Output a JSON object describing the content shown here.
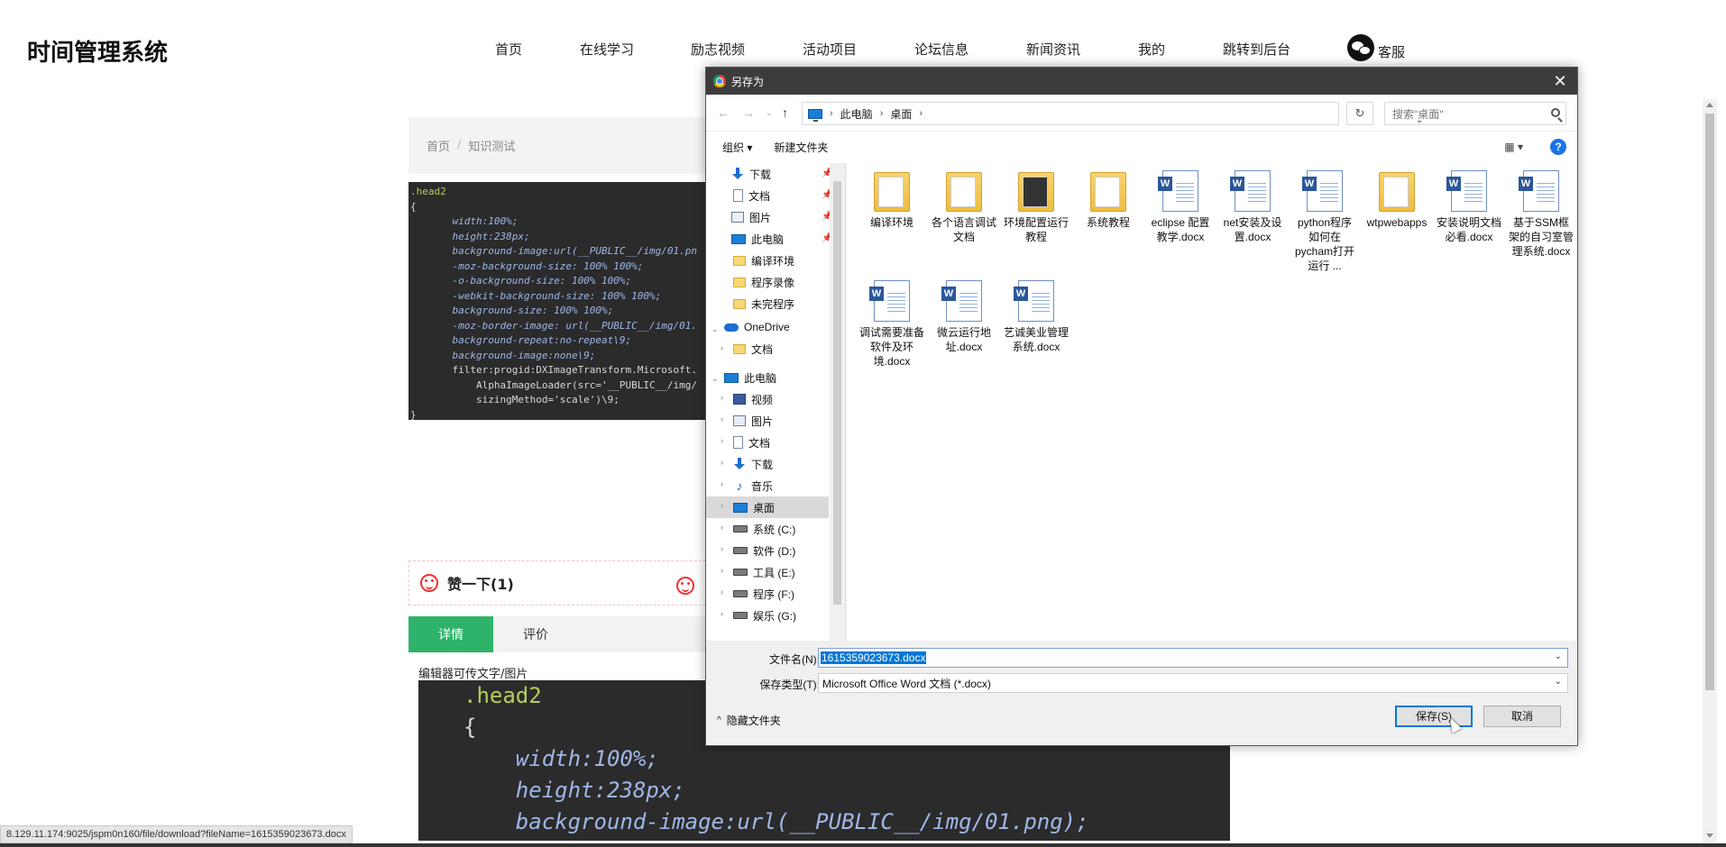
{
  "site": {
    "logo": "时间管理系统",
    "nav": [
      "首页",
      "在线学习",
      "励志视频",
      "活动项目",
      "论坛信息",
      "新闻资讯",
      "我的",
      "跳转到后台"
    ],
    "service": "客服"
  },
  "breadcrumb": {
    "home": "首页",
    "sep": "/",
    "current": "知识测试"
  },
  "code_small": [
    ".head2",
    "{",
    "    width:100%;",
    "    height:238px;",
    "    background-image:url(__PUBLIC__/img/01.pn",
    "    -moz-background-size: 100% 100%;",
    "    -o-background-size: 100% 100%;",
    "    -webkit-background-size: 100% 100%;",
    "    background-size: 100% 100%;",
    "    -moz-border-image: url(__PUBLIC__/img/01.",
    "    background-repeat:no-repeat\\9;",
    "    background-image:none\\9;",
    "    filter:progid:DXImageTransform.Microsoft.",
    "        AlphaImageLoader(src='__PUBLIC__/img/",
    "        sizingMethod='scale')\\9;",
    "}"
  ],
  "like": {
    "label": "赞一下(1)"
  },
  "tabs": {
    "detail": "详情",
    "review": "评价"
  },
  "editor_note": "编辑器可传文字/图片",
  "code_big": [
    ".head2",
    "{",
    "    width:100%;",
    "    height:238px;",
    "    background-image:url(__PUBLIC__/img/01.png);"
  ],
  "status_url": "8.129.11.174:9025/jspm0n160/file/download?fileName=1615359023673.docx",
  "dialog": {
    "title": "另存为",
    "close": "✕",
    "path": [
      "此电脑",
      "桌面"
    ],
    "search_placeholder": "搜索\"桌面\"",
    "toolbar": {
      "organize": "组织 ▾",
      "new_folder": "新建文件夹",
      "help": "?"
    },
    "tree": [
      {
        "label": "下载",
        "icon": "download-icon",
        "pinned": true
      },
      {
        "label": "文档",
        "icon": "document-icon",
        "pinned": true
      },
      {
        "label": "图片",
        "icon": "picture-icon",
        "pinned": true
      },
      {
        "label": "此电脑",
        "icon": "computer-icon",
        "pinned": true
      },
      {
        "label": "编译环境",
        "icon": "folder-icon"
      },
      {
        "label": "程序录像",
        "icon": "folder-icon"
      },
      {
        "label": "未完程序",
        "icon": "folder-icon"
      },
      {
        "label": "OneDrive",
        "icon": "onedrive-icon"
      },
      {
        "label": "文档",
        "icon": "folder-icon"
      },
      {
        "label": "此电脑",
        "icon": "computer-icon"
      },
      {
        "label": "视频",
        "icon": "video-icon"
      },
      {
        "label": "图片",
        "icon": "picture-icon"
      },
      {
        "label": "文档",
        "icon": "document-icon"
      },
      {
        "label": "下载",
        "icon": "download-icon"
      },
      {
        "label": "音乐",
        "icon": "music-icon"
      },
      {
        "label": "桌面",
        "icon": "desktop-icon",
        "selected": true
      },
      {
        "label": "系统 (C:)",
        "icon": "drive-icon"
      },
      {
        "label": "软件 (D:)",
        "icon": "drive-icon"
      },
      {
        "label": "工具 (E:)",
        "icon": "drive-icon"
      },
      {
        "label": "程序 (F:)",
        "icon": "drive-icon"
      },
      {
        "label": "娱乐 (G:)",
        "icon": "drive-icon"
      }
    ],
    "files": [
      {
        "name": "编译环境",
        "type": "folder"
      },
      {
        "name": "各个语言调试文档",
        "type": "folder"
      },
      {
        "name": "环境配置运行教程",
        "type": "folder"
      },
      {
        "name": "系统教程",
        "type": "folder"
      },
      {
        "name": "eclipse 配置教学.docx",
        "type": "word"
      },
      {
        "name": "net安装及设置.docx",
        "type": "word"
      },
      {
        "name": "python程序如何在pycham打开运行 ...",
        "type": "word"
      },
      {
        "name": "wtpwebapps",
        "type": "folder"
      },
      {
        "name": "安装说明文档必看.docx",
        "type": "word"
      },
      {
        "name": "基于SSM框架的自习室管理系统.docx",
        "type": "word"
      },
      {
        "name": "调试需要准备软件及环境.docx",
        "type": "word"
      },
      {
        "name": "微云运行地址.docx",
        "type": "word"
      },
      {
        "name": "艺诚美业管理系统.docx",
        "type": "word"
      }
    ],
    "filename_label": "文件名(N):",
    "filename_value": "1615359023673.docx",
    "filetype_label": "保存类型(T):",
    "filetype_value": "Microsoft Office Word 文档 (*.docx)",
    "hide_folders": "隐藏文件夹",
    "save_button": "保存(S)",
    "cancel_button": "取消"
  }
}
